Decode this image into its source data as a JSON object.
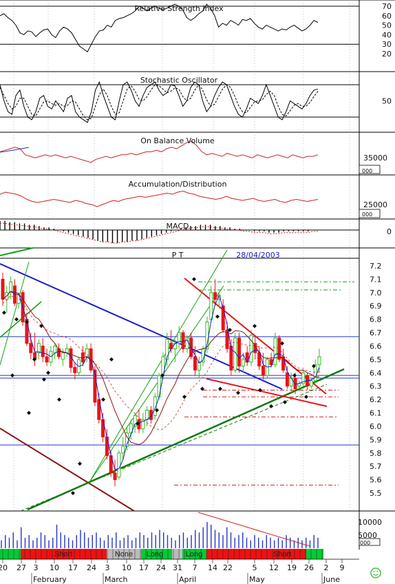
{
  "chart_data": {
    "type": "candlestick",
    "price_panel": {
      "label": "P T",
      "date": "28/04/2003",
      "yticks": [
        "7.2",
        "7.1",
        "7.0",
        "6.9",
        "6.8",
        "6.7",
        "6.6",
        "6.5",
        "6.4",
        "6.3",
        "6.2",
        "6.1",
        "6.0",
        "5.9",
        "5.8",
        "5.7",
        "5.6",
        "5.5"
      ],
      "ylim": [
        5.42,
        7.28
      ],
      "candles": [
        {
          "o": 7.1,
          "h": 7.15,
          "l": 6.9,
          "c": 6.95
        },
        {
          "o": 6.95,
          "h": 7.05,
          "l": 6.85,
          "c": 7.0
        },
        {
          "o": 7.0,
          "h": 7.12,
          "l": 6.95,
          "c": 7.08
        },
        {
          "o": 7.05,
          "h": 7.1,
          "l": 6.9,
          "c": 6.92
        },
        {
          "o": 6.92,
          "h": 7.0,
          "l": 6.88,
          "c": 6.98
        },
        {
          "o": 7.0,
          "h": 7.02,
          "l": 6.75,
          "c": 6.78
        },
        {
          "o": 6.8,
          "h": 6.85,
          "l": 6.6,
          "c": 6.62
        },
        {
          "o": 6.62,
          "h": 6.7,
          "l": 6.5,
          "c": 6.55
        },
        {
          "o": 6.55,
          "h": 6.7,
          "l": 6.45,
          "c": 6.5
        },
        {
          "o": 6.55,
          "h": 6.65,
          "l": 6.5,
          "c": 6.62
        },
        {
          "o": 6.6,
          "h": 6.66,
          "l": 6.48,
          "c": 6.52
        },
        {
          "o": 6.52,
          "h": 6.58,
          "l": 6.45,
          "c": 6.48
        },
        {
          "o": 6.48,
          "h": 6.6,
          "l": 6.45,
          "c": 6.56
        },
        {
          "o": 6.55,
          "h": 6.62,
          "l": 6.5,
          "c": 6.6
        },
        {
          "o": 6.58,
          "h": 6.62,
          "l": 6.5,
          "c": 6.52
        },
        {
          "o": 6.5,
          "h": 6.58,
          "l": 6.45,
          "c": 6.55
        },
        {
          "o": 6.55,
          "h": 6.62,
          "l": 6.52,
          "c": 6.58
        },
        {
          "o": 6.58,
          "h": 6.6,
          "l": 6.4,
          "c": 6.44
        },
        {
          "o": 6.44,
          "h": 6.48,
          "l": 6.35,
          "c": 6.4
        },
        {
          "o": 6.4,
          "h": 6.52,
          "l": 6.38,
          "c": 6.5
        },
        {
          "o": 6.55,
          "h": 6.6,
          "l": 6.45,
          "c": 6.48
        },
        {
          "o": 6.52,
          "h": 6.62,
          "l": 6.48,
          "c": 6.58
        },
        {
          "o": 6.58,
          "h": 6.62,
          "l": 6.4,
          "c": 6.42
        },
        {
          "o": 6.42,
          "h": 6.45,
          "l": 6.15,
          "c": 6.18
        },
        {
          "o": 6.2,
          "h": 6.25,
          "l": 6.02,
          "c": 6.05
        },
        {
          "o": 6.05,
          "h": 6.1,
          "l": 5.88,
          "c": 5.92
        },
        {
          "o": 5.92,
          "h": 5.98,
          "l": 5.75,
          "c": 5.78
        },
        {
          "o": 5.78,
          "h": 5.82,
          "l": 5.62,
          "c": 5.65
        },
        {
          "o": 5.65,
          "h": 5.75,
          "l": 5.55,
          "c": 5.6
        },
        {
          "o": 5.62,
          "h": 5.82,
          "l": 5.6,
          "c": 5.8
        },
        {
          "o": 5.8,
          "h": 5.92,
          "l": 5.75,
          "c": 5.85
        },
        {
          "o": 5.85,
          "h": 6.0,
          "l": 5.82,
          "c": 5.95
        },
        {
          "o": 5.95,
          "h": 6.05,
          "l": 5.9,
          "c": 6.02
        },
        {
          "o": 6.0,
          "h": 6.1,
          "l": 5.95,
          "c": 6.08
        },
        {
          "o": 6.05,
          "h": 6.12,
          "l": 5.95,
          "c": 5.98
        },
        {
          "o": 5.98,
          "h": 6.1,
          "l": 5.95,
          "c": 6.05
        },
        {
          "o": 6.05,
          "h": 6.15,
          "l": 6.0,
          "c": 6.12
        },
        {
          "o": 6.12,
          "h": 6.15,
          "l": 6.02,
          "c": 6.05
        },
        {
          "o": 6.08,
          "h": 6.25,
          "l": 6.05,
          "c": 6.22
        },
        {
          "o": 6.22,
          "h": 6.4,
          "l": 6.2,
          "c": 6.38
        },
        {
          "o": 6.38,
          "h": 6.55,
          "l": 6.35,
          "c": 6.52
        },
        {
          "o": 6.5,
          "h": 6.7,
          "l": 6.45,
          "c": 6.65
        },
        {
          "o": 6.62,
          "h": 6.72,
          "l": 6.55,
          "c": 6.58
        },
        {
          "o": 6.58,
          "h": 6.65,
          "l": 6.48,
          "c": 6.62
        },
        {
          "o": 6.62,
          "h": 6.75,
          "l": 6.58,
          "c": 6.7
        },
        {
          "o": 6.7,
          "h": 6.72,
          "l": 6.55,
          "c": 6.58
        },
        {
          "o": 6.58,
          "h": 6.68,
          "l": 6.55,
          "c": 6.66
        },
        {
          "o": 6.66,
          "h": 6.7,
          "l": 6.5,
          "c": 6.52
        },
        {
          "o": 6.52,
          "h": 6.6,
          "l": 6.38,
          "c": 6.42
        },
        {
          "o": 6.42,
          "h": 6.52,
          "l": 6.36,
          "c": 6.48
        },
        {
          "o": 6.48,
          "h": 6.6,
          "l": 6.45,
          "c": 6.58
        },
        {
          "o": 6.58,
          "h": 6.82,
          "l": 6.55,
          "c": 6.78
        },
        {
          "o": 6.8,
          "h": 7.05,
          "l": 6.78,
          "c": 7.0
        },
        {
          "o": 7.0,
          "h": 7.1,
          "l": 6.9,
          "c": 6.95
        },
        {
          "o": 6.95,
          "h": 7.0,
          "l": 6.88,
          "c": 6.98
        },
        {
          "o": 6.9,
          "h": 6.95,
          "l": 6.7,
          "c": 6.72
        },
        {
          "o": 6.72,
          "h": 6.78,
          "l": 6.55,
          "c": 6.58
        },
        {
          "o": 6.6,
          "h": 6.65,
          "l": 6.38,
          "c": 6.42
        },
        {
          "o": 6.42,
          "h": 6.7,
          "l": 6.4,
          "c": 6.66
        },
        {
          "o": 6.66,
          "h": 6.7,
          "l": 6.4,
          "c": 6.45
        },
        {
          "o": 6.45,
          "h": 6.55,
          "l": 6.4,
          "c": 6.5
        },
        {
          "o": 6.55,
          "h": 6.6,
          "l": 6.45,
          "c": 6.48
        },
        {
          "o": 6.48,
          "h": 6.72,
          "l": 6.45,
          "c": 6.68
        },
        {
          "o": 6.62,
          "h": 6.68,
          "l": 6.5,
          "c": 6.55
        },
        {
          "o": 6.55,
          "h": 6.6,
          "l": 6.42,
          "c": 6.45
        },
        {
          "o": 6.45,
          "h": 6.55,
          "l": 6.35,
          "c": 6.38
        },
        {
          "o": 6.38,
          "h": 6.52,
          "l": 6.36,
          "c": 6.5
        },
        {
          "o": 6.5,
          "h": 6.55,
          "l": 6.44,
          "c": 6.46
        },
        {
          "o": 6.46,
          "h": 6.7,
          "l": 6.44,
          "c": 6.66
        },
        {
          "o": 6.66,
          "h": 6.68,
          "l": 6.48,
          "c": 6.5
        },
        {
          "o": 6.52,
          "h": 6.58,
          "l": 6.4,
          "c": 6.42
        },
        {
          "o": 6.4,
          "h": 6.45,
          "l": 6.28,
          "c": 6.3
        },
        {
          "o": 6.3,
          "h": 6.4,
          "l": 6.25,
          "c": 6.36
        },
        {
          "o": 6.36,
          "h": 6.4,
          "l": 6.24,
          "c": 6.28
        },
        {
          "o": 6.3,
          "h": 6.34,
          "l": 6.26,
          "c": 6.32
        },
        {
          "o": 6.32,
          "h": 6.42,
          "l": 6.3,
          "c": 6.4
        },
        {
          "o": 6.38,
          "h": 6.4,
          "l": 6.27,
          "c": 6.3
        },
        {
          "o": 6.3,
          "h": 6.36,
          "l": 6.28,
          "c": 6.34
        },
        {
          "o": 6.34,
          "h": 6.5,
          "l": 6.32,
          "c": 6.46
        },
        {
          "o": 6.46,
          "h": 6.58,
          "l": 6.4,
          "c": 6.52
        }
      ],
      "colors": {
        "up": "#33bb22",
        "down": "#e8151a",
        "blue": "#2233cc",
        "green": "#11a011",
        "trend_green": "#0a7a0a",
        "trend_red": "#e8151a",
        "maroon": "#8b1414",
        "tl_blue": "#1a1acc",
        "dots": "#111111"
      }
    },
    "rsi_panel": {
      "title": "Relative Strength Index",
      "yticks": [
        "70",
        "60",
        "50",
        "40",
        "30",
        "20"
      ],
      "ylim": [
        17,
        73
      ],
      "levels": [
        70,
        30
      ],
      "values": [
        60,
        62,
        58,
        55,
        50,
        42,
        40,
        44,
        43,
        38,
        42,
        45,
        46,
        40,
        37,
        44,
        48,
        46,
        42,
        35,
        28,
        25,
        22,
        30,
        38,
        44,
        45,
        50,
        48,
        55,
        57,
        58,
        60,
        62,
        65,
        70,
        68,
        65,
        68,
        70,
        68,
        66,
        68,
        70,
        72,
        70,
        66,
        58,
        55,
        58,
        62,
        65,
        72,
        68,
        60,
        48,
        52,
        50,
        55,
        53,
        50,
        56,
        55,
        57,
        52,
        48,
        46,
        50,
        48,
        46,
        44,
        46,
        45,
        48,
        50,
        47,
        44,
        46,
        50,
        55,
        53
      ]
    },
    "stoch_panel": {
      "title": "Stochastic Oscillator",
      "yticks": [
        "50"
      ],
      "ylim": [
        0,
        100
      ],
      "levels": [
        80,
        20
      ],
      "k": [
        80,
        50,
        30,
        25,
        60,
        70,
        40,
        20,
        15,
        30,
        55,
        60,
        40,
        35,
        50,
        40,
        30,
        55,
        60,
        30,
        20,
        15,
        10,
        30,
        70,
        85,
        60,
        40,
        20,
        15,
        50,
        80,
        85,
        70,
        50,
        40,
        60,
        75,
        80,
        85,
        70,
        60,
        65,
        80,
        78,
        60,
        40,
        50,
        75,
        85,
        80,
        50,
        30,
        40,
        60,
        75,
        85,
        80,
        60,
        40,
        25,
        20,
        35,
        55,
        50,
        45,
        60,
        80,
        60,
        40,
        20,
        15,
        30,
        50,
        45,
        40,
        35,
        45,
        60,
        70,
        72
      ],
      "d": [
        75,
        60,
        45,
        35,
        40,
        55,
        55,
        40,
        25,
        22,
        35,
        48,
        50,
        45,
        42,
        45,
        40,
        42,
        50,
        48,
        35,
        22,
        15,
        18,
        40,
        62,
        72,
        60,
        40,
        25,
        28,
        50,
        72,
        78,
        68,
        53,
        50,
        58,
        70,
        80,
        78,
        72,
        65,
        68,
        74,
        72,
        58,
        50,
        55,
        70,
        80,
        70,
        52,
        40,
        44,
        58,
        72,
        80,
        75,
        60,
        42,
        30,
        28,
        38,
        48,
        50,
        52,
        62,
        68,
        60,
        40,
        25,
        22,
        32,
        42,
        45,
        40,
        40,
        47,
        58,
        68
      ]
    },
    "obv_panel": {
      "title": "On Balance Volume",
      "ytick": "35000",
      "unit": "000",
      "values": [
        38,
        39,
        40,
        41,
        40,
        36,
        35,
        34,
        35,
        36,
        35,
        36,
        35,
        34,
        35,
        34,
        33,
        32,
        31,
        33,
        34,
        35,
        34,
        35,
        36,
        36,
        37,
        36,
        37,
        38,
        38,
        39,
        38,
        40,
        41,
        40,
        42,
        44,
        45,
        42,
        38,
        36,
        37,
        36,
        35,
        37,
        36,
        35,
        36,
        35,
        34,
        36,
        35,
        34,
        35,
        36,
        35,
        34,
        36,
        35,
        34,
        35,
        35,
        36
      ]
    },
    "ad_panel": {
      "title": "Accumulation/Distribution",
      "ytick": "25000",
      "unit": "000",
      "values": [
        40,
        42,
        41,
        40,
        38,
        35,
        33,
        32,
        33,
        34,
        35,
        34,
        33,
        32,
        34,
        33,
        31,
        30,
        28,
        30,
        32,
        34,
        33,
        35,
        36,
        37,
        38,
        37,
        38,
        39,
        40,
        41,
        40,
        42,
        43,
        41,
        40,
        38,
        37,
        36,
        35,
        36,
        38,
        36,
        35,
        34,
        35,
        36,
        34,
        33,
        34,
        35,
        33,
        32,
        34,
        35,
        34,
        33,
        34,
        35
      ]
    },
    "macd_panel": {
      "title": "MACD",
      "ytick": "0",
      "hist": [
        7,
        7,
        6,
        6,
        5,
        5,
        4,
        4,
        3,
        2,
        2,
        1,
        0,
        -1,
        -2,
        -3,
        -4,
        -5,
        -6,
        -7,
        -8,
        -9,
        -9,
        -10,
        -10,
        -9,
        -9,
        -8,
        -8,
        -7,
        -6,
        -5,
        -4,
        -3,
        -2,
        -1,
        0,
        1,
        2,
        3,
        3,
        4,
        4,
        4,
        3,
        3,
        2,
        2,
        1,
        1,
        0,
        0,
        -1,
        -1,
        -1,
        -2,
        -2,
        -2,
        -1,
        -1,
        -1,
        -1,
        -1,
        -1,
        0,
        0
      ]
    },
    "volume_panel": {
      "yticks": [
        "10000",
        "5000"
      ],
      "unit": "000",
      "values": [
        3,
        5,
        4,
        6,
        3,
        8,
        4,
        5,
        3,
        4,
        6,
        5,
        3,
        4,
        9,
        6,
        5,
        4,
        3,
        5,
        7,
        6,
        4,
        5,
        6,
        4,
        3,
        5,
        4,
        6,
        3,
        4,
        5,
        3,
        4,
        6,
        5,
        4,
        6,
        5,
        7,
        6,
        5,
        4,
        3,
        5,
        6,
        4,
        5,
        7,
        6,
        8,
        10,
        9,
        7,
        6,
        5,
        8,
        6,
        4,
        5,
        6,
        4,
        3,
        5,
        4,
        3,
        5,
        4,
        3,
        4,
        3,
        5,
        4,
        3,
        4,
        3,
        4,
        3,
        5,
        4
      ]
    },
    "signal_band": [
      {
        "label": "",
        "color": "green"
      },
      {
        "label": "Short",
        "color": "red"
      },
      {
        "label": "None",
        "color": "gray"
      },
      {
        "label": "Long",
        "color": "green"
      },
      {
        "label": "",
        "color": "gray"
      },
      {
        "label": "Long",
        "color": "green"
      },
      {
        "label": "",
        "color": "red"
      },
      {
        "label": "Short",
        "color": "red"
      },
      {
        "label": "",
        "color": "green"
      }
    ],
    "x_day_ticks": [
      "20",
      "27",
      "3",
      "10",
      "17",
      "24",
      "3",
      "10",
      "17",
      "24",
      "31",
      "7",
      "14",
      "22",
      "5",
      "12",
      "19",
      "26",
      "2",
      "9"
    ],
    "x_months": [
      "February",
      "March",
      "April",
      "May",
      "June"
    ]
  }
}
